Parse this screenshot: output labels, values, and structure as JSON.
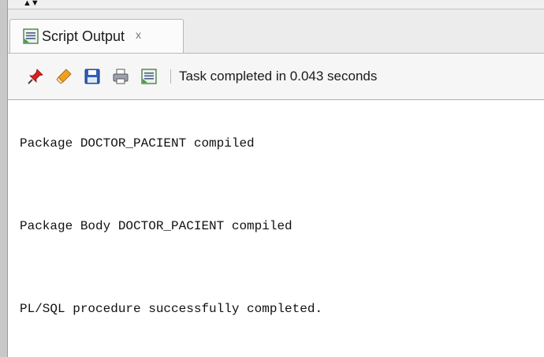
{
  "panel": {
    "collapse_arrows": "▲▼",
    "tab": {
      "icon": "script-output-icon",
      "label": "Script Output",
      "close": "x"
    }
  },
  "toolbar": {
    "buttons": [
      {
        "name": "pin-icon"
      },
      {
        "name": "eraser-icon"
      },
      {
        "name": "save-icon"
      },
      {
        "name": "print-icon"
      },
      {
        "name": "script-output-icon"
      }
    ],
    "status": "Task completed in 0.043 seconds"
  },
  "output": {
    "lines": [
      "Package DOCTOR_PACIENT compiled",
      "Package Body DOCTOR_PACIENT compiled",
      "PL/SQL procedure successfully completed."
    ]
  },
  "colors": {
    "pin": "#d42020",
    "eraser": "#f0a020",
    "save": "#2f5fb8",
    "tab_icon": "#3aa03a"
  }
}
